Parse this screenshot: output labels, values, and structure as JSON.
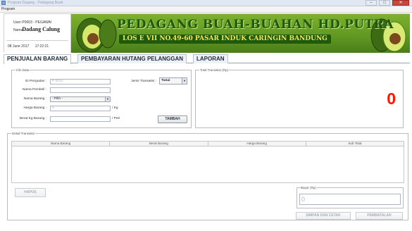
{
  "window": {
    "title": "Program Dagang - Pedagang Buah",
    "close_glyph": "✕",
    "min_glyph": "–",
    "max_glyph": "□"
  },
  "menu": {
    "program_label": "Program"
  },
  "user": {
    "user_label": "User:",
    "user_value": "P0003 - PEGAWAI",
    "nama_label": "Nama",
    "nama_value": "Dadang Calung",
    "date": "08 June 2017",
    "time": "17:22:21"
  },
  "banner": {
    "line1": "PEDAGANG BUAH-BUAHAN HD.PUTRA",
    "line2": "LOS E VII NO.49-60 PASAR INDUK CARINGIN BANDUNG"
  },
  "tabs": [
    {
      "label": "PENJUALAN BARANG",
      "active": true
    },
    {
      "label": "PEMBAYARAN HUTANG PELANGGAN",
      "active": false
    },
    {
      "label": "LAPORAN",
      "active": false
    }
  ],
  "info": {
    "legend": "Info Data",
    "id_label": "ID Penjualan :",
    "id_value": "P 0014",
    "nama_pembeli_label": "Nama Pembeli :",
    "nama_pembeli_value": "",
    "nama_barang_label": "Nama Barang :",
    "nama_barang_value": "- Pilih -",
    "harga_label": "Harga Barang :",
    "harga_value": "0",
    "harga_unit": "/ Kg",
    "berat_label": "Berat Kg Barang :",
    "berat_value": "",
    "berat_unit": "/ Peti",
    "jenis_label": "Jenis Transaksi :",
    "jenis_value": "Tunai",
    "tambah_label": "TAMBAH"
  },
  "total": {
    "legend": "Total Transaksi (Rp)",
    "value": "0"
  },
  "detail": {
    "legend": "Detail Transaksi",
    "columns": [
      "Nama Barang",
      "Berat Barang",
      "Harga Barang",
      "Sub Total"
    ]
  },
  "actions": {
    "hapus_label": "HAPUS",
    "bayar_legend": "Bayar (Rp)",
    "bayar_value": "0",
    "simpan_label": "SIMPAN DAN CETAK",
    "batal_label": "PEMBATALAN"
  },
  "colors": {
    "total_accent": "#ff1500",
    "banner_green": "#5f9722",
    "banner_text": "#1e5a0c",
    "banner_subtext": "#f3e35b"
  }
}
